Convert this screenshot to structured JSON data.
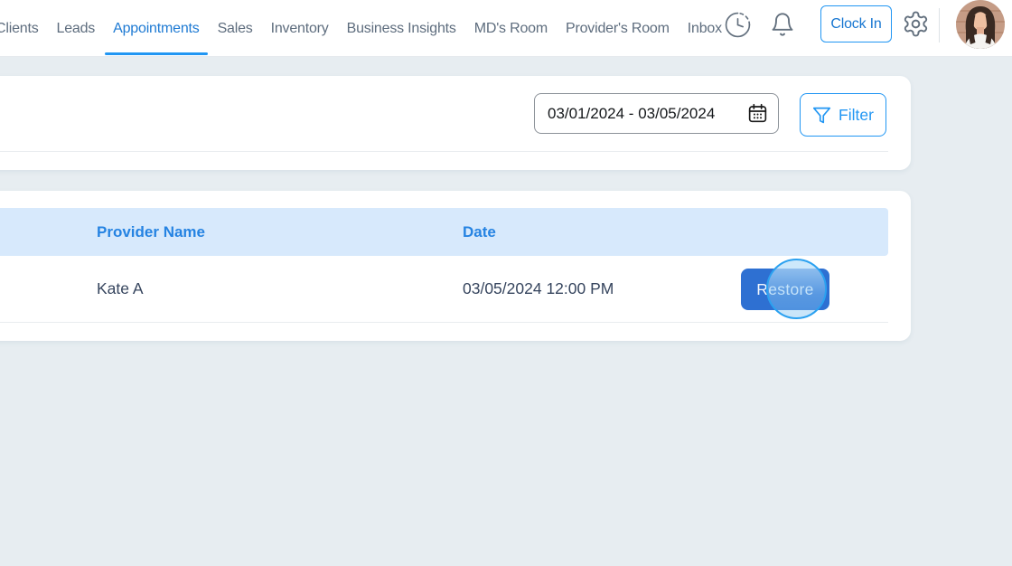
{
  "nav": {
    "items": [
      {
        "label": "Clients",
        "active": false
      },
      {
        "label": "Leads",
        "active": false
      },
      {
        "label": "Appointments",
        "active": true
      },
      {
        "label": "Sales",
        "active": false
      },
      {
        "label": "Inventory",
        "active": false
      },
      {
        "label": "Business Insights",
        "active": false
      },
      {
        "label": "MD's Room",
        "active": false
      },
      {
        "label": "Provider's Room",
        "active": false
      },
      {
        "label": "Inbox",
        "active": false
      }
    ],
    "clock_in_label": "Clock In"
  },
  "filter_panel": {
    "date_range_value": "03/01/2024 - 03/05/2024",
    "filter_button_label": "Filter"
  },
  "table": {
    "columns": [
      "Provider Name",
      "Date"
    ],
    "rows": [
      {
        "provider_name": "Kate A",
        "date": "03/05/2024 12:00 PM",
        "action_label": "Restore"
      }
    ]
  },
  "icons": {
    "clock_history": "time-clock-icon",
    "bell": "notification-bell-icon",
    "gear": "settings-gear-icon",
    "calendar": "calendar-icon",
    "funnel": "filter-funnel-icon",
    "avatar": "user-avatar"
  },
  "click_indicator": {
    "target": "restore-button",
    "color": "#2ba1f0"
  },
  "colors": {
    "accent": "#2196f3",
    "active_nav_text": "#1e7ad3",
    "table_header_bg": "#d7e9fc",
    "table_header_text": "#2583e2",
    "restore_button_bg": "#2e70d2",
    "row_text": "#36455e",
    "page_background": "#e7edf1"
  }
}
